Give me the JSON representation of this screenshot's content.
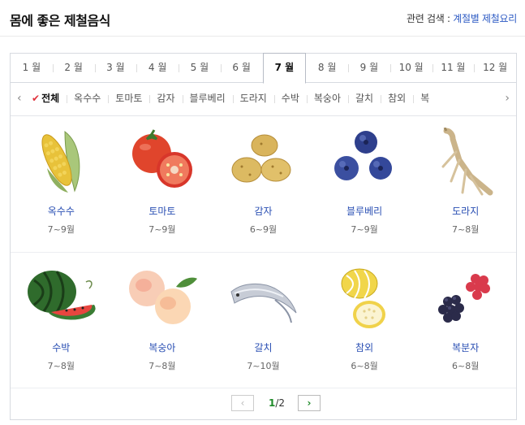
{
  "header": {
    "title": "몸에 좋은 제철음식",
    "related_label": "관련 검색 : ",
    "related_links": [
      "계절별",
      "제철요리"
    ]
  },
  "months": [
    "1 월",
    "2 월",
    "3 월",
    "4 월",
    "5 월",
    "6 월",
    "7 월",
    "8 월",
    "9 월",
    "10 월",
    "11 월",
    "12 월"
  ],
  "active_month_index": 6,
  "food_filter": {
    "check_icon": "check-icon",
    "items": [
      "전체",
      "옥수수",
      "토마토",
      "감자",
      "블루베리",
      "도라지",
      "수박",
      "복숭아",
      "갈치",
      "참외",
      "복"
    ]
  },
  "rows": [
    [
      {
        "name": "옥수수",
        "period": "7~9월",
        "icon": "corn-image"
      },
      {
        "name": "토마토",
        "period": "7~9월",
        "icon": "tomato-image"
      },
      {
        "name": "감자",
        "period": "6~9월",
        "icon": "potato-image"
      },
      {
        "name": "블루베리",
        "period": "7~9월",
        "icon": "blueberry-image"
      },
      {
        "name": "도라지",
        "period": "7~8월",
        "icon": "bellflower-root-image"
      }
    ],
    [
      {
        "name": "수박",
        "period": "7~8월",
        "icon": "watermelon-image"
      },
      {
        "name": "복숭아",
        "period": "7~8월",
        "icon": "peach-image"
      },
      {
        "name": "갈치",
        "period": "7~10월",
        "icon": "hairtail-fish-image"
      },
      {
        "name": "참외",
        "period": "6~8월",
        "icon": "korean-melon-image"
      },
      {
        "name": "복분자",
        "period": "6~8월",
        "icon": "raspberry-image"
      }
    ]
  ],
  "pager": {
    "current": "1",
    "separator": "/",
    "total": "2"
  }
}
